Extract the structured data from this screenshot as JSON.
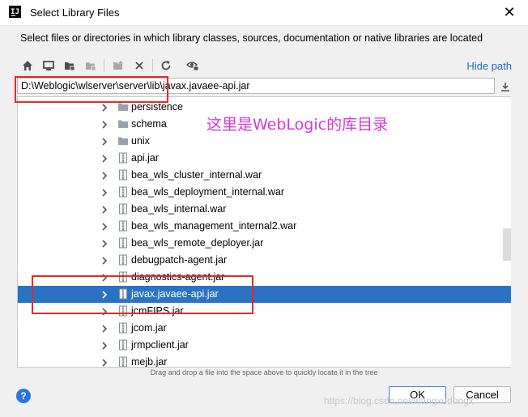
{
  "window": {
    "title": "Select Library Files",
    "close_glyph": "✕"
  },
  "description": "Select files or directories in which library classes, sources, documentation or native libraries are located",
  "toolbar": {
    "icons": [
      "home-icon",
      "desktop-icon",
      "project-folder-icon",
      "module-folder-icon",
      "new-folder-icon",
      "delete-icon",
      "refresh-icon",
      "show-hidden-icon"
    ],
    "hide_path_label": "Hide path"
  },
  "path": {
    "value": "D:\\Weblogic\\wlserver\\server\\lib\\javax.javaee-api.jar"
  },
  "tree": {
    "items": [
      {
        "label": "persistence",
        "type": "folder",
        "selected": false
      },
      {
        "label": "schema",
        "type": "folder",
        "selected": false
      },
      {
        "label": "unix",
        "type": "folder",
        "selected": false
      },
      {
        "label": "api.jar",
        "type": "jar",
        "selected": false
      },
      {
        "label": "bea_wls_cluster_internal.war",
        "type": "jar",
        "selected": false
      },
      {
        "label": "bea_wls_deployment_internal.war",
        "type": "jar",
        "selected": false
      },
      {
        "label": "bea_wls_internal.war",
        "type": "jar",
        "selected": false
      },
      {
        "label": "bea_wls_management_internal2.war",
        "type": "jar",
        "selected": false
      },
      {
        "label": "bea_wls_remote_deployer.jar",
        "type": "jar",
        "selected": false
      },
      {
        "label": "debugpatch-agent.jar",
        "type": "jar",
        "selected": false
      },
      {
        "label": "diagnostics-agent.jar",
        "type": "jar",
        "selected": false
      },
      {
        "label": "javax.javaee-api.jar",
        "type": "jar",
        "selected": true
      },
      {
        "label": "jcmFIPS.jar",
        "type": "jar",
        "selected": false
      },
      {
        "label": "jcom.jar",
        "type": "jar",
        "selected": false
      },
      {
        "label": "jrmpclient.jar",
        "type": "jar",
        "selected": false
      },
      {
        "label": "mejb.jar",
        "type": "jar",
        "selected": false
      }
    ]
  },
  "annotation": "这里是WebLogic的库目录",
  "hint": "Drag and drop a file into the space above to quickly locate it in the tree",
  "buttons": {
    "help": "?",
    "ok": "OK",
    "cancel": "Cancel"
  },
  "watermark": "https://blog.csdn.net/wangxudongx",
  "colors": {
    "selection": "#2a73c2",
    "link": "#2470b3",
    "annotation": "#d636d6",
    "highlight_box": "#e22b2b"
  }
}
